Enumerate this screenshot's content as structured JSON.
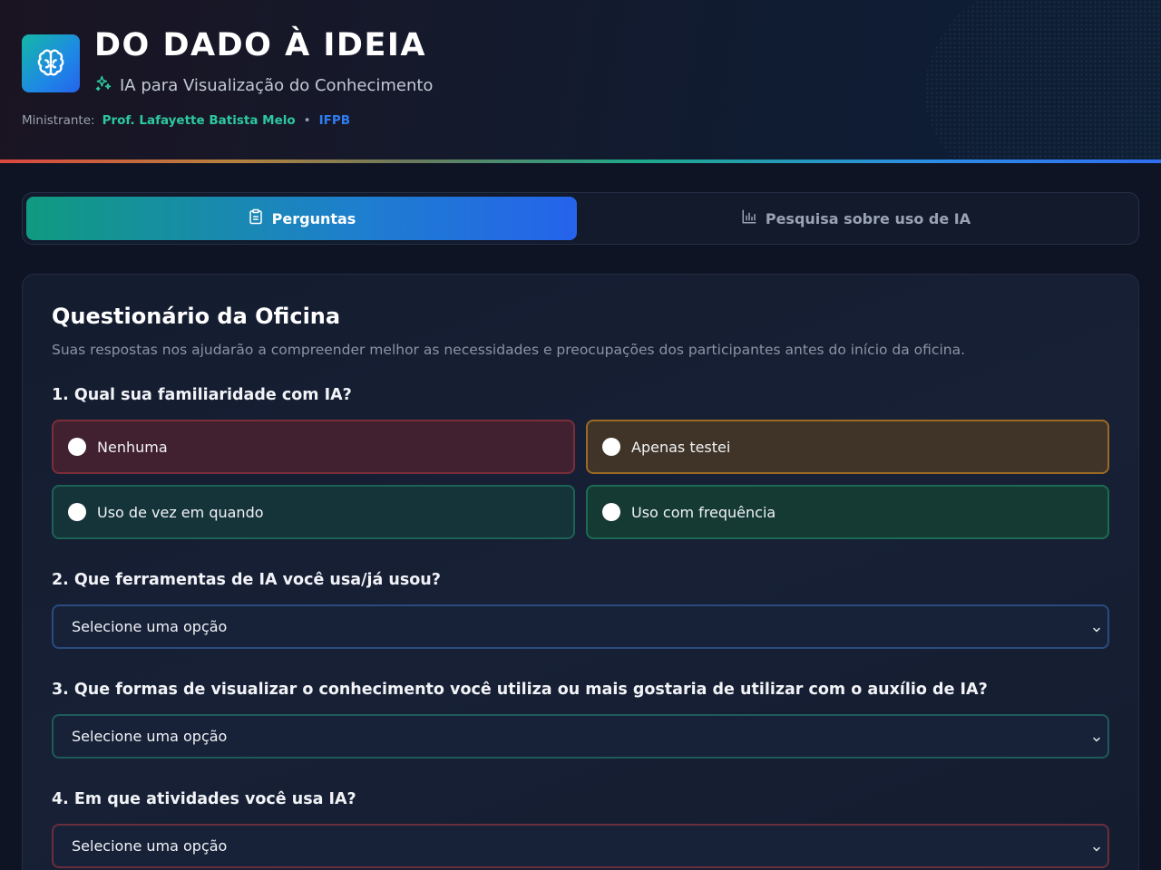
{
  "header": {
    "title": "DO DADO À IDEIA",
    "subtitle": "IA para Visualização do Conhecimento",
    "credits_label": "Ministrante:",
    "instructor": "Prof. Lafayette Batista Melo",
    "separator": "•",
    "institution": "IFPB",
    "icons": {
      "logo": "brain-icon",
      "subtitle": "sparkles-icon"
    }
  },
  "tabs": [
    {
      "label": "Perguntas",
      "icon": "clipboard-icon",
      "active": true
    },
    {
      "label": "Pesquisa sobre uso de IA",
      "icon": "bar-chart-icon",
      "active": false
    }
  ],
  "form": {
    "title": "Questionário da Oficina",
    "description": "Suas respostas nos ajudarão a compreender melhor as necessidades e preocupações dos participantes antes do início da oficina.",
    "q1": {
      "label": "1. Qual sua familiaridade com IA?",
      "options": [
        "Nenhuma",
        "Apenas testei",
        "Uso de vez em quando",
        "Uso com frequência"
      ]
    },
    "q2": {
      "label": "2. Que ferramentas de IA você usa/já usou?",
      "value": "Selecione uma opção"
    },
    "q3": {
      "label": "3. Que formas de visualizar o conhecimento você utiliza ou mais gostaria de utilizar com o auxílio de IA?",
      "value": "Selecione uma opção"
    },
    "q4": {
      "label": "4. Em que atividades você usa IA?",
      "value": "Selecione uma opção"
    }
  },
  "colors": {
    "accent_teal": "#109a80",
    "accent_blue": "#2563eb",
    "instructor_green": "#2dc9a0",
    "institution_blue": "#2f7cf0"
  }
}
